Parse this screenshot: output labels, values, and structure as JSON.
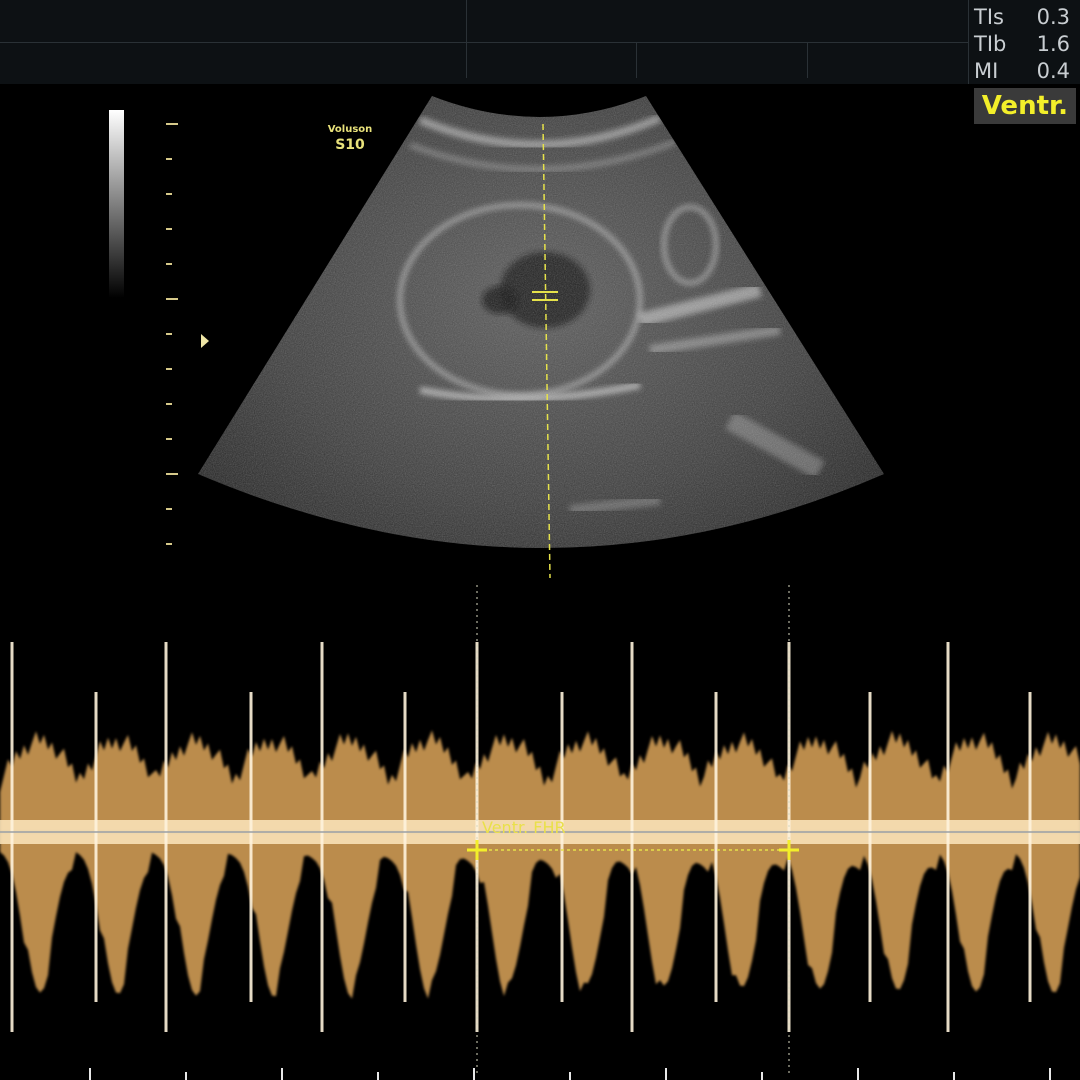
{
  "readouts": [
    {
      "label": "TIs",
      "value": "0.3"
    },
    {
      "label": "TIb",
      "value": "1.6"
    },
    {
      "label": "MI",
      "value": "0.4"
    }
  ],
  "mode_label": "Ventr.",
  "brand": {
    "line1": "Voluson",
    "line2": "S10"
  },
  "measurement": {
    "label": "Ventr. FHR"
  },
  "colors": {
    "annotation": "#f3ef2a",
    "doppler": "#f0b462",
    "background": "#000000"
  },
  "icons": {
    "focus_marker": "focus-marker-icon",
    "caliper": "caliper-cross-icon"
  }
}
